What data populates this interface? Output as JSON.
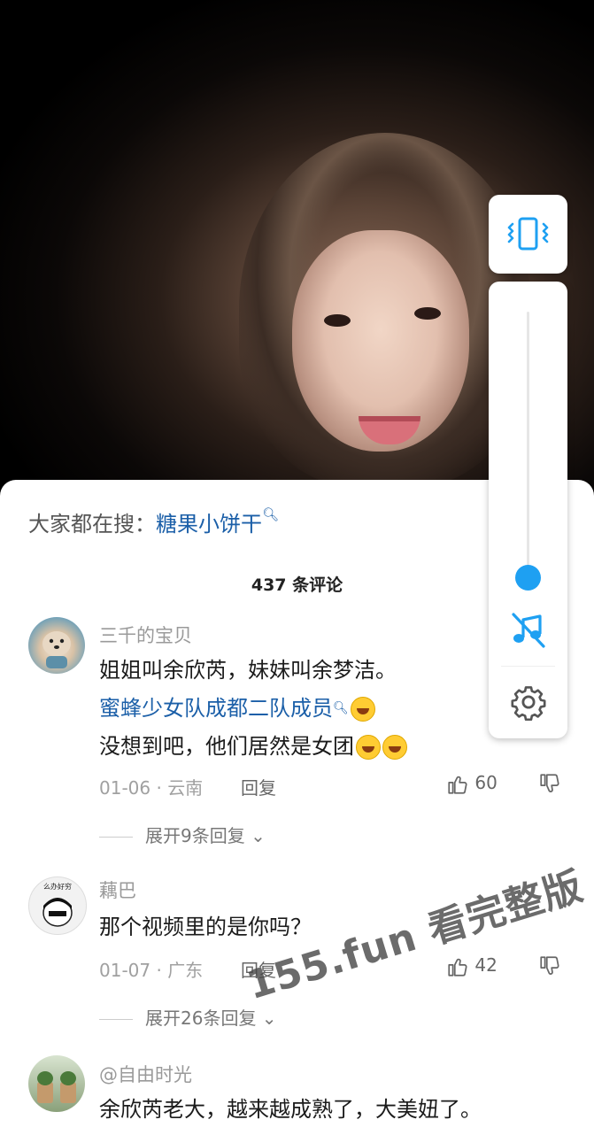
{
  "search_bar": {
    "prefix": "大家都在搜：",
    "keyword": "糖果小饼干"
  },
  "comment_count": "437 条评论",
  "comments": [
    {
      "username": "三千的宝贝",
      "line1": "姐姐叫余欣芮，妹妹叫余梦洁。",
      "line2_link": "蜜蜂少女队成都二队成员",
      "line3": "没想到吧，他们居然是女团",
      "date_loc": "01-06 · 云南",
      "reply": "回复",
      "likes": "60",
      "expand": "展开9条回复"
    },
    {
      "username": "藕巴",
      "avatar_text": "么办好穷",
      "line1": "那个视频里的是你吗？",
      "date_loc": "01-07 · 广东",
      "reply": "回复",
      "likes": "42",
      "expand": "展开26条回复"
    },
    {
      "username": "@自由时光",
      "line1": "余欣芮老大，越来越成熟了，大美妞了。"
    }
  ],
  "watermark": "155.fun 看完整版",
  "colors": {
    "accent": "#1ea0f2",
    "link": "#1b5fa8"
  }
}
